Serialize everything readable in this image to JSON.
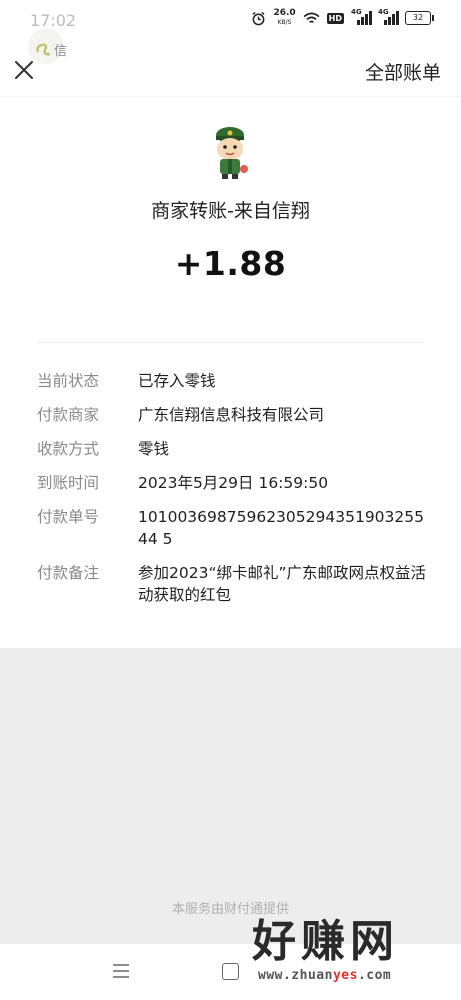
{
  "status_bar": {
    "time": "17:02",
    "net_speed": "26.0",
    "net_unit": "KB/S",
    "hd": "HD",
    "signal1": "4G",
    "signal2": "4G",
    "battery": "32"
  },
  "mini_avatar_text": "信",
  "nav": {
    "close_icon": "close-icon",
    "all_bills_label": "全部账单"
  },
  "transaction": {
    "title": "商家转账-来自信翔",
    "amount": "+1.88"
  },
  "details": [
    {
      "label": "当前状态",
      "value": "已存入零钱"
    },
    {
      "label": "付款商家",
      "value": "广东信翔信息科技有限公司"
    },
    {
      "label": "收款方式",
      "value": "零钱"
    },
    {
      "label": "到账时间",
      "value": "2023年5月29日 16:59:50"
    },
    {
      "label": "付款单号",
      "value": "1010036987596230529435190325544 5"
    },
    {
      "label": "付款备注",
      "value": "参加2023“绑卡邮礼”广东邮政网点权益活动获取的红包"
    }
  ],
  "footer": "本服务由财付通提供",
  "watermark": {
    "main": "好赚网",
    "sub_pre": "www.zhuan",
    "sub_hl": "yes",
    "sub_post": ".com"
  },
  "colors": {
    "background": "#ffffff",
    "gray_area": "#ededed",
    "label": "#8a8a8a",
    "watermark_accent": "#e0322d"
  }
}
